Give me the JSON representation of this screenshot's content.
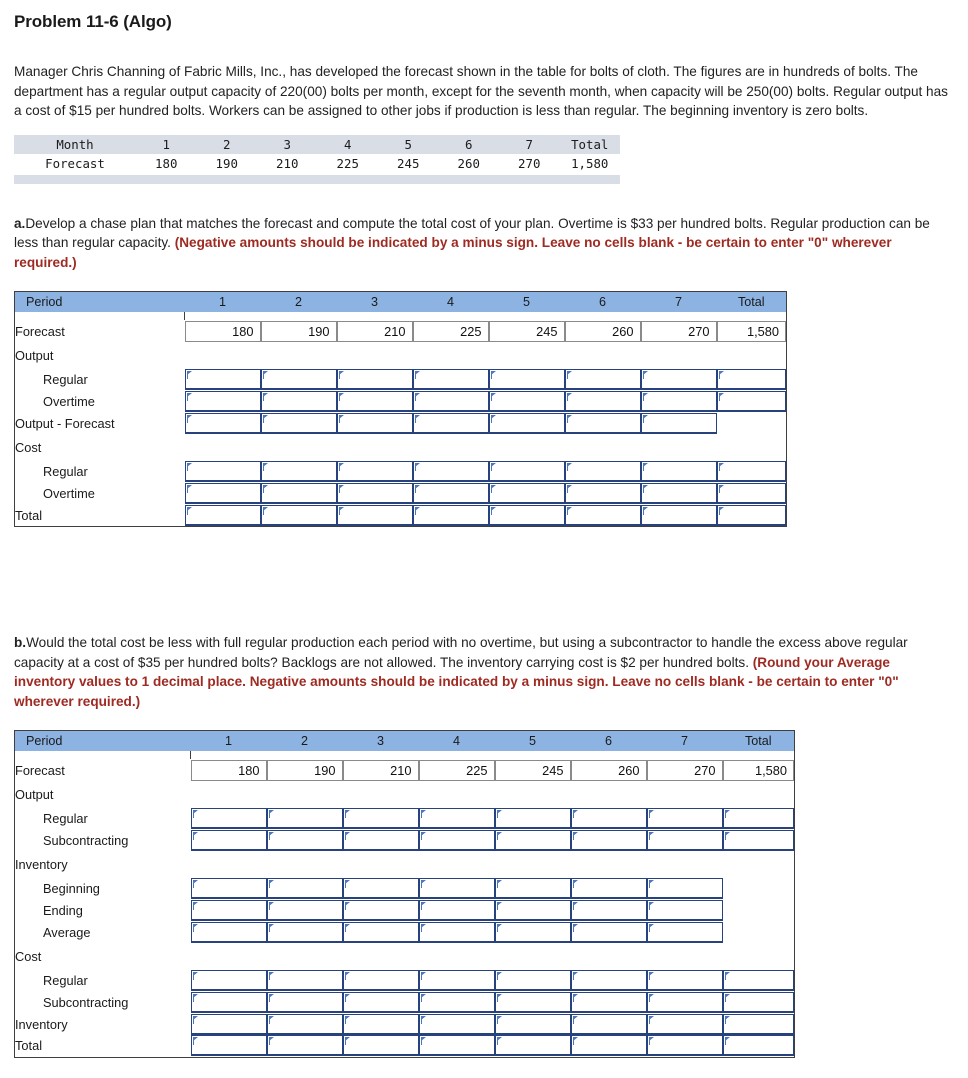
{
  "title": "Problem 11-6 (Algo)",
  "intro": "Manager Chris Channing of Fabric Mills, Inc., has developed the forecast shown in the table for bolts of cloth. The figures are in hundreds of bolts. The department has a regular output capacity of 220(00) bolts per month, except for the seventh month, when capacity will be 250(00) bolts. Regular output has a cost of $15 per hundred bolts. Workers can be assigned to other jobs if production is less than regular. The beginning inventory is zero bolts.",
  "forecast_table": {
    "header": [
      "Month",
      "1",
      "2",
      "3",
      "4",
      "5",
      "6",
      "7",
      "Total"
    ],
    "row_label": "Forecast",
    "values": [
      "180",
      "190",
      "210",
      "225",
      "245",
      "260",
      "270",
      "1,580"
    ]
  },
  "question_a": {
    "label": "a.",
    "text": "Develop a chase plan that matches the forecast and compute the total cost of your plan. Overtime is $33 per hundred bolts. Regular production can be less than regular capacity. ",
    "instruction": "(Negative amounts should be indicated by a minus sign. Leave no cells blank - be certain to enter \"0\" wherever required.)"
  },
  "question_b": {
    "label": "b.",
    "text": "Would the total cost be less with full regular production each period with no overtime, but using a subcontractor to handle the excess above regular capacity at a cost of $35 per hundred bolts? Backlogs are not allowed. The inventory carrying cost is $2 per hundred bolts. ",
    "instruction": "(Round your Average inventory values to 1 decimal place. Negative amounts should be indicated by a minus sign. Leave no cells blank - be certain to enter \"0\" wherever required.)"
  },
  "worksheet_a": {
    "header": [
      "Period",
      "1",
      "2",
      "3",
      "4",
      "5",
      "6",
      "7",
      "Total"
    ],
    "forecast_label": "Forecast",
    "forecast_values": [
      "180",
      "190",
      "210",
      "225",
      "245",
      "260",
      "270",
      "1,580"
    ],
    "rows": [
      {
        "label": "Output",
        "indent": false,
        "type": "section"
      },
      {
        "label": "Regular",
        "indent": true,
        "type": "input",
        "total_input": true
      },
      {
        "label": "Overtime",
        "indent": true,
        "type": "input",
        "total_input": true
      },
      {
        "label": "Output - Forecast",
        "indent": false,
        "type": "input",
        "total_input": false
      },
      {
        "label": "Cost",
        "indent": false,
        "type": "section"
      },
      {
        "label": "Regular",
        "indent": true,
        "type": "input",
        "total_input": true
      },
      {
        "label": "Overtime",
        "indent": true,
        "type": "input",
        "total_input": true
      },
      {
        "label": "Total",
        "indent": false,
        "type": "input",
        "total_input": true
      }
    ]
  },
  "worksheet_b": {
    "header": [
      "Period",
      "1",
      "2",
      "3",
      "4",
      "5",
      "6",
      "7",
      "Total"
    ],
    "forecast_label": "Forecast",
    "forecast_values": [
      "180",
      "190",
      "210",
      "225",
      "245",
      "260",
      "270",
      "1,580"
    ],
    "rows": [
      {
        "label": "Output",
        "indent": false,
        "type": "section"
      },
      {
        "label": "Regular",
        "indent": true,
        "type": "input",
        "total_input": true
      },
      {
        "label": "Subcontracting",
        "indent": true,
        "type": "input",
        "total_input": true
      },
      {
        "label": "Inventory",
        "indent": false,
        "type": "section"
      },
      {
        "label": "Beginning",
        "indent": true,
        "type": "input",
        "total_input": false
      },
      {
        "label": "Ending",
        "indent": true,
        "type": "input",
        "total_input": false
      },
      {
        "label": "Average",
        "indent": true,
        "type": "input",
        "total_input": false
      },
      {
        "label": "Cost",
        "indent": false,
        "type": "section"
      },
      {
        "label": "Regular",
        "indent": true,
        "type": "input",
        "total_input": true
      },
      {
        "label": "Subcontracting",
        "indent": true,
        "type": "input",
        "total_input": true
      },
      {
        "label": "Inventory",
        "indent": false,
        "type": "input",
        "total_input": true
      },
      {
        "label": "Total",
        "indent": false,
        "type": "input",
        "total_input": true
      }
    ]
  },
  "colors": {
    "header_blue": "#8db3e2",
    "input_border": "#27427c",
    "flag_blue": "#4a77bd",
    "instruction_red": "#9e2a21",
    "mono_band": "#d9dde5"
  }
}
